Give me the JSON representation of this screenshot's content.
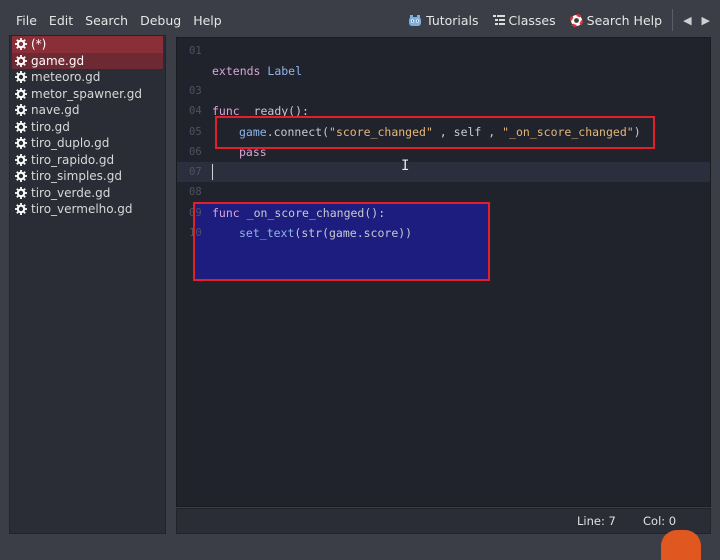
{
  "menu": [
    "File",
    "Edit",
    "Search",
    "Debug",
    "Help"
  ],
  "toolbar": {
    "tutorials": "Tutorials",
    "classes": "Classes",
    "search_help": "Search Help"
  },
  "files": [
    "(*)",
    "game.gd",
    "meteoro.gd",
    "metor_spawner.gd",
    "nave.gd",
    "tiro.gd",
    "tiro_duplo.gd",
    "tiro_rapido.gd",
    "tiro_simples.gd",
    "tiro_verde.gd",
    "tiro_vermelho.gd"
  ],
  "code": {
    "ln01": "01",
    "ln03": "03",
    "ln04": "04",
    "ln05": "05",
    "ln06": "06",
    "ln07": "07",
    "ln08": "08",
    "ln09": "09",
    "ln10": "10",
    "l3_kw": "extends",
    "l3_cls": "Label",
    "l4_kw": "func",
    "l4_name": "_ready():",
    "l5_obj": "game",
    "l5_method": ".connect(",
    "l5_str1": "\"score_changed\"",
    "l5_mid": " , self , ",
    "l5_str2": "\"_on_score_changed\"",
    "l5_end": ")",
    "l6": "pass",
    "l9_kw": "func",
    "l9_name": "_on_score_changed():",
    "l10_fn": "set_text",
    "l10_rest": "(str(game.score))"
  },
  "status": {
    "line": "Line: 7",
    "col": "Col: 0"
  }
}
